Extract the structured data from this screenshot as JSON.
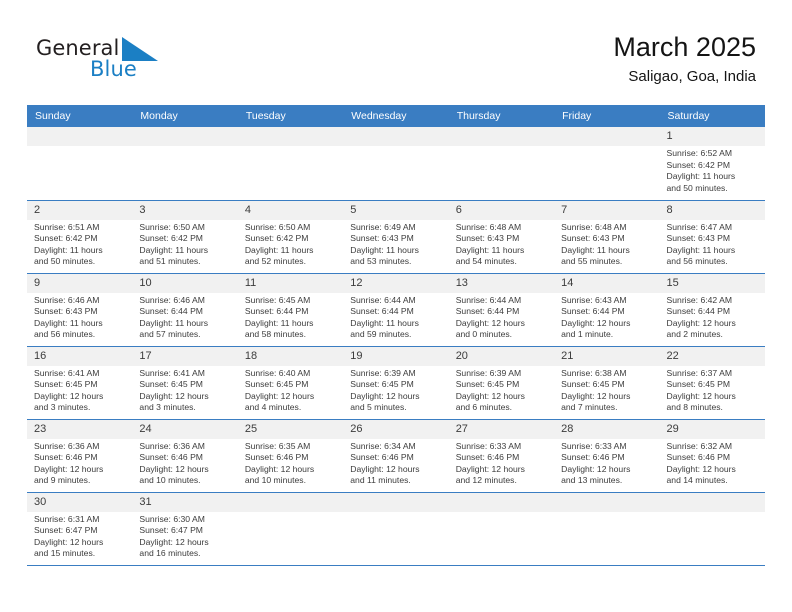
{
  "brand": {
    "name_top": "General",
    "name_bottom": "Blue",
    "accent_color": "#1b7fc4",
    "text_color": "#231f20"
  },
  "header": {
    "title": "March 2025",
    "subtitle": "Saligao, Goa, India"
  },
  "theme": {
    "header_bar_color": "#3a7dc2",
    "daynum_band_color": "#f1f1f1",
    "row_rule_color": "#3a7dc2",
    "body_text_color": "#3c3c3c"
  },
  "weekdays": [
    "Sunday",
    "Monday",
    "Tuesday",
    "Wednesday",
    "Thursday",
    "Friday",
    "Saturday"
  ],
  "weeks": [
    [
      {
        "day": "",
        "lines": [
          "",
          "",
          "",
          ""
        ],
        "empty": true
      },
      {
        "day": "",
        "lines": [
          "",
          "",
          "",
          ""
        ],
        "empty": true
      },
      {
        "day": "",
        "lines": [
          "",
          "",
          "",
          ""
        ],
        "empty": true
      },
      {
        "day": "",
        "lines": [
          "",
          "",
          "",
          ""
        ],
        "empty": true
      },
      {
        "day": "",
        "lines": [
          "",
          "",
          "",
          ""
        ],
        "empty": true
      },
      {
        "day": "",
        "lines": [
          "",
          "",
          "",
          ""
        ],
        "empty": true
      },
      {
        "day": "1",
        "lines": [
          "Sunrise: 6:52 AM",
          "Sunset: 6:42 PM",
          "Daylight: 11 hours",
          "and 50 minutes."
        ],
        "empty": false
      }
    ],
    [
      {
        "day": "2",
        "lines": [
          "Sunrise: 6:51 AM",
          "Sunset: 6:42 PM",
          "Daylight: 11 hours",
          "and 50 minutes."
        ],
        "empty": false
      },
      {
        "day": "3",
        "lines": [
          "Sunrise: 6:50 AM",
          "Sunset: 6:42 PM",
          "Daylight: 11 hours",
          "and 51 minutes."
        ],
        "empty": false
      },
      {
        "day": "4",
        "lines": [
          "Sunrise: 6:50 AM",
          "Sunset: 6:42 PM",
          "Daylight: 11 hours",
          "and 52 minutes."
        ],
        "empty": false
      },
      {
        "day": "5",
        "lines": [
          "Sunrise: 6:49 AM",
          "Sunset: 6:43 PM",
          "Daylight: 11 hours",
          "and 53 minutes."
        ],
        "empty": false
      },
      {
        "day": "6",
        "lines": [
          "Sunrise: 6:48 AM",
          "Sunset: 6:43 PM",
          "Daylight: 11 hours",
          "and 54 minutes."
        ],
        "empty": false
      },
      {
        "day": "7",
        "lines": [
          "Sunrise: 6:48 AM",
          "Sunset: 6:43 PM",
          "Daylight: 11 hours",
          "and 55 minutes."
        ],
        "empty": false
      },
      {
        "day": "8",
        "lines": [
          "Sunrise: 6:47 AM",
          "Sunset: 6:43 PM",
          "Daylight: 11 hours",
          "and 56 minutes."
        ],
        "empty": false
      }
    ],
    [
      {
        "day": "9",
        "lines": [
          "Sunrise: 6:46 AM",
          "Sunset: 6:43 PM",
          "Daylight: 11 hours",
          "and 56 minutes."
        ],
        "empty": false
      },
      {
        "day": "10",
        "lines": [
          "Sunrise: 6:46 AM",
          "Sunset: 6:44 PM",
          "Daylight: 11 hours",
          "and 57 minutes."
        ],
        "empty": false
      },
      {
        "day": "11",
        "lines": [
          "Sunrise: 6:45 AM",
          "Sunset: 6:44 PM",
          "Daylight: 11 hours",
          "and 58 minutes."
        ],
        "empty": false
      },
      {
        "day": "12",
        "lines": [
          "Sunrise: 6:44 AM",
          "Sunset: 6:44 PM",
          "Daylight: 11 hours",
          "and 59 minutes."
        ],
        "empty": false
      },
      {
        "day": "13",
        "lines": [
          "Sunrise: 6:44 AM",
          "Sunset: 6:44 PM",
          "Daylight: 12 hours",
          "and 0 minutes."
        ],
        "empty": false
      },
      {
        "day": "14",
        "lines": [
          "Sunrise: 6:43 AM",
          "Sunset: 6:44 PM",
          "Daylight: 12 hours",
          "and 1 minute."
        ],
        "empty": false
      },
      {
        "day": "15",
        "lines": [
          "Sunrise: 6:42 AM",
          "Sunset: 6:44 PM",
          "Daylight: 12 hours",
          "and 2 minutes."
        ],
        "empty": false
      }
    ],
    [
      {
        "day": "16",
        "lines": [
          "Sunrise: 6:41 AM",
          "Sunset: 6:45 PM",
          "Daylight: 12 hours",
          "and 3 minutes."
        ],
        "empty": false
      },
      {
        "day": "17",
        "lines": [
          "Sunrise: 6:41 AM",
          "Sunset: 6:45 PM",
          "Daylight: 12 hours",
          "and 3 minutes."
        ],
        "empty": false
      },
      {
        "day": "18",
        "lines": [
          "Sunrise: 6:40 AM",
          "Sunset: 6:45 PM",
          "Daylight: 12 hours",
          "and 4 minutes."
        ],
        "empty": false
      },
      {
        "day": "19",
        "lines": [
          "Sunrise: 6:39 AM",
          "Sunset: 6:45 PM",
          "Daylight: 12 hours",
          "and 5 minutes."
        ],
        "empty": false
      },
      {
        "day": "20",
        "lines": [
          "Sunrise: 6:39 AM",
          "Sunset: 6:45 PM",
          "Daylight: 12 hours",
          "and 6 minutes."
        ],
        "empty": false
      },
      {
        "day": "21",
        "lines": [
          "Sunrise: 6:38 AM",
          "Sunset: 6:45 PM",
          "Daylight: 12 hours",
          "and 7 minutes."
        ],
        "empty": false
      },
      {
        "day": "22",
        "lines": [
          "Sunrise: 6:37 AM",
          "Sunset: 6:45 PM",
          "Daylight: 12 hours",
          "and 8 minutes."
        ],
        "empty": false
      }
    ],
    [
      {
        "day": "23",
        "lines": [
          "Sunrise: 6:36 AM",
          "Sunset: 6:46 PM",
          "Daylight: 12 hours",
          "and 9 minutes."
        ],
        "empty": false
      },
      {
        "day": "24",
        "lines": [
          "Sunrise: 6:36 AM",
          "Sunset: 6:46 PM",
          "Daylight: 12 hours",
          "and 10 minutes."
        ],
        "empty": false
      },
      {
        "day": "25",
        "lines": [
          "Sunrise: 6:35 AM",
          "Sunset: 6:46 PM",
          "Daylight: 12 hours",
          "and 10 minutes."
        ],
        "empty": false
      },
      {
        "day": "26",
        "lines": [
          "Sunrise: 6:34 AM",
          "Sunset: 6:46 PM",
          "Daylight: 12 hours",
          "and 11 minutes."
        ],
        "empty": false
      },
      {
        "day": "27",
        "lines": [
          "Sunrise: 6:33 AM",
          "Sunset: 6:46 PM",
          "Daylight: 12 hours",
          "and 12 minutes."
        ],
        "empty": false
      },
      {
        "day": "28",
        "lines": [
          "Sunrise: 6:33 AM",
          "Sunset: 6:46 PM",
          "Daylight: 12 hours",
          "and 13 minutes."
        ],
        "empty": false
      },
      {
        "day": "29",
        "lines": [
          "Sunrise: 6:32 AM",
          "Sunset: 6:46 PM",
          "Daylight: 12 hours",
          "and 14 minutes."
        ],
        "empty": false
      }
    ],
    [
      {
        "day": "30",
        "lines": [
          "Sunrise: 6:31 AM",
          "Sunset: 6:47 PM",
          "Daylight: 12 hours",
          "and 15 minutes."
        ],
        "empty": false
      },
      {
        "day": "31",
        "lines": [
          "Sunrise: 6:30 AM",
          "Sunset: 6:47 PM",
          "Daylight: 12 hours",
          "and 16 minutes."
        ],
        "empty": false
      },
      {
        "day": "",
        "lines": [
          "",
          "",
          "",
          ""
        ],
        "empty": true
      },
      {
        "day": "",
        "lines": [
          "",
          "",
          "",
          ""
        ],
        "empty": true
      },
      {
        "day": "",
        "lines": [
          "",
          "",
          "",
          ""
        ],
        "empty": true
      },
      {
        "day": "",
        "lines": [
          "",
          "",
          "",
          ""
        ],
        "empty": true
      },
      {
        "day": "",
        "lines": [
          "",
          "",
          "",
          ""
        ],
        "empty": true
      }
    ]
  ]
}
